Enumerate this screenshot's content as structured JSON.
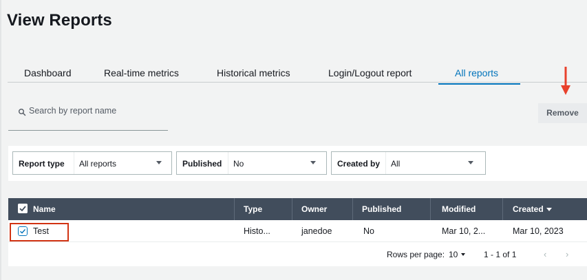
{
  "page": {
    "title": "View Reports"
  },
  "tabs": [
    {
      "label": "Dashboard"
    },
    {
      "label": "Real-time metrics"
    },
    {
      "label": "Historical metrics"
    },
    {
      "label": "Login/Logout report"
    },
    {
      "label": "All reports",
      "active": true
    }
  ],
  "search": {
    "placeholder": "Search by report name",
    "value": ""
  },
  "actions": {
    "remove_label": "Remove"
  },
  "filters": [
    {
      "label": "Report type",
      "value": "All reports"
    },
    {
      "label": "Published",
      "value": "No"
    },
    {
      "label": "Created by",
      "value": "All"
    }
  ],
  "table": {
    "columns": [
      "Name",
      "Type",
      "Owner",
      "Published",
      "Modified",
      "Created"
    ],
    "sort": {
      "column": "Created",
      "direction": "descending"
    },
    "rows": [
      {
        "name": "Test",
        "type": "Histo...",
        "owner": "janedoe",
        "published": "No",
        "modified": "Mar 10, 2...",
        "created": "Mar 10, 2023",
        "selected": true
      }
    ],
    "footer": {
      "rows_per_page_label": "Rows per page:",
      "rows_per_page_value": "10",
      "range": "1 - 1 of 1"
    }
  },
  "colors": {
    "accent": "#0073bb",
    "header_bg": "#414d5c",
    "highlight": "#d13212",
    "annotation_arrow": "#e8412c"
  },
  "icons": [
    "search-icon",
    "chevron-down-icon",
    "checkbox-icon",
    "sort-descending-icon",
    "chevron-left-icon",
    "chevron-right-icon",
    "arrow-down-annotation"
  ]
}
